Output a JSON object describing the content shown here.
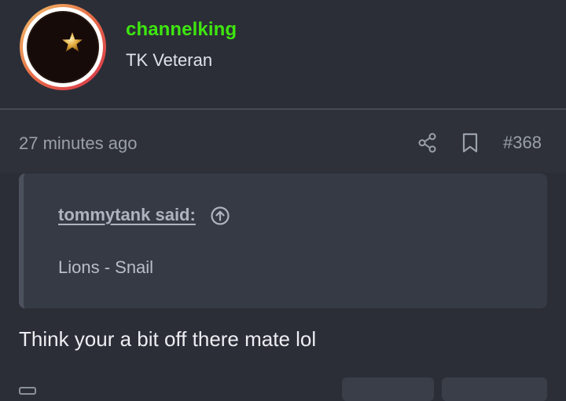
{
  "post_author": {
    "username": "channelking",
    "title": "TK Veteran",
    "avatar_icon": "crescent-star-icon",
    "username_color": "#3ee60f"
  },
  "post_meta": {
    "timestamp": "27 minutes ago",
    "share_icon": "share-icon",
    "bookmark_icon": "bookmark-icon",
    "post_number": "#368"
  },
  "quote": {
    "author_label": "tommytank said:",
    "jump_icon": "arrow-up-circle-icon",
    "text": "Lions - Snail"
  },
  "post": {
    "body": "Think your a bit off there mate lol"
  },
  "colors": {
    "background": "#2b2e37",
    "quote_background": "#363a45",
    "muted_text": "#9aa0ab"
  }
}
